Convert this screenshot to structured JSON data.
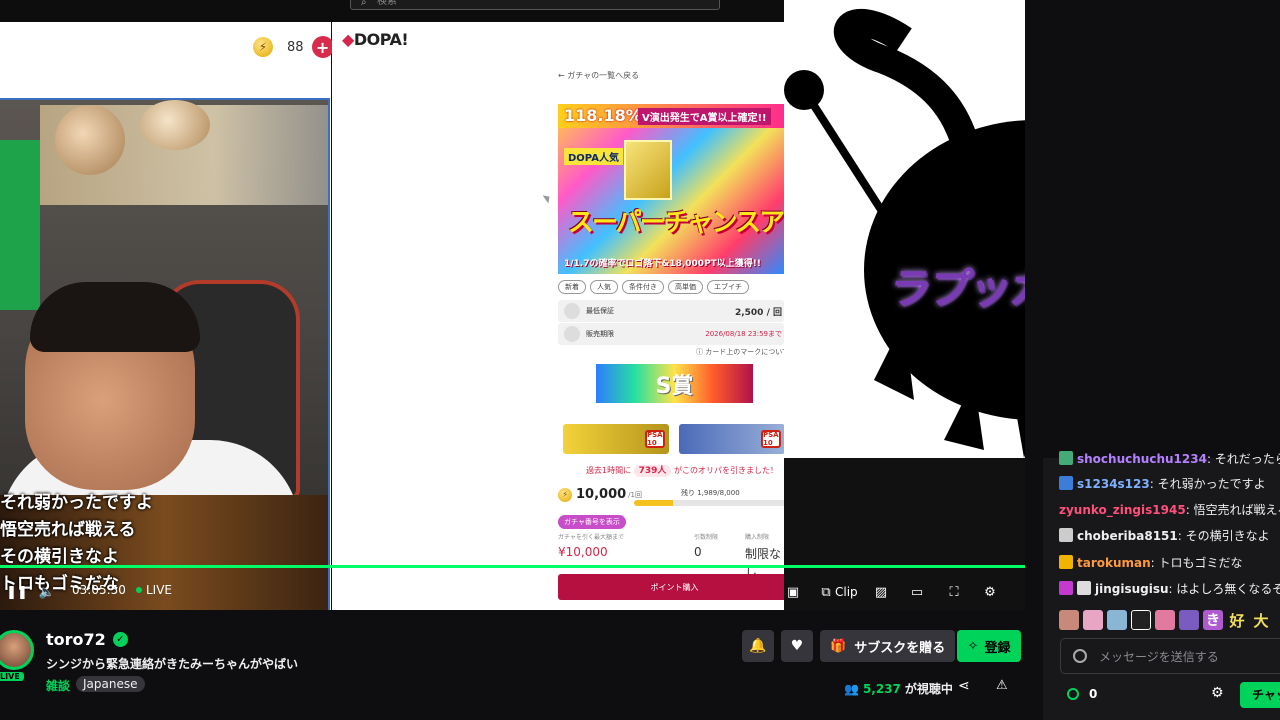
{
  "browser": {
    "search_placeholder": "検索"
  },
  "wallet": {
    "coins": "88",
    "plus_glyph": "+"
  },
  "subtitles": [
    "それ弱かったですよ",
    "悟空売れば戦える",
    "その横引きなよ",
    "トロもゴミだな"
  ],
  "dopa": {
    "logo": "DOPA!",
    "back_link": "← ガチャの一覧へ戻る",
    "banner": {
      "percent": "118.18%",
      "caption": "V演出発生でA賞以上確定!!",
      "badge": "DOPA人気",
      "main": "スーパーチャンスアップ",
      "bottom": "1/1.7の確率でロゴ落下&18,000PT以上獲得!!"
    },
    "tags": [
      "新着",
      "人気",
      "条件付き",
      "高単価",
      "エブイチ"
    ],
    "rows": [
      {
        "label": "最低保証",
        "value": "2,500 / 回"
      },
      {
        "label": "販売期限",
        "value": "2026/08/18 23:59まで"
      }
    ],
    "card_mark_link": "カード上のマークについて",
    "s_prize": "S賞",
    "prize_badge": "PSA 10",
    "history": {
      "prefix": "過去1時間に",
      "count": "739人",
      "suffix": "がこのオリパを引きました！"
    },
    "price": "10,000",
    "price_unit": "/1回",
    "remaining_label": "残り 1,989/8,000",
    "remaining_fraction": 0.249,
    "pill": "ガチャ番号を表示",
    "stats": [
      {
        "label": "ガチャを引く最大額まで",
        "value": "¥10,000"
      },
      {
        "label": "引数制限",
        "value": "0"
      },
      {
        "label": "購入制限",
        "value": "制限なし"
      }
    ],
    "buy_button": "ポイント購入"
  },
  "artwork": {
    "title": "ラプッカーズ"
  },
  "player": {
    "time": "03:05:50",
    "live_label": "LIVE",
    "clip_label": "Clip"
  },
  "chat": {
    "messages": [
      {
        "user": "shochuchuchu1234",
        "text": ": それだったら…",
        "color": "#b580ff"
      },
      {
        "user": "s1234s123",
        "text": ": それ弱かったですよ",
        "color": "#7fb0ff"
      },
      {
        "user": "zyunko_zingis1945",
        "text": ": 悟空売れば戦える",
        "color": "#ff4f7a"
      },
      {
        "user": "choberiba8151",
        "text": ": その横引きなよ",
        "color": "#efeff1"
      },
      {
        "user": "tarokuman",
        "text": ": トロもゴミだな",
        "color": "#ff9a3c"
      },
      {
        "user": "jingisugisu",
        "text": ": はよしろ無くなるぞ",
        "color": "#efeff1"
      }
    ],
    "emote_text": [
      "き",
      "好",
      "大"
    ],
    "input_placeholder": "メッセージを送信する",
    "points": "0",
    "chat_button": "チャット"
  },
  "stream": {
    "channel": "toro72",
    "live_tag": "LIVE",
    "title": "シンジから緊急連絡がきたみーちゃんがやばい",
    "category": "雑談",
    "language": "Japanese",
    "gift_button": "サブスクを贈る",
    "subscribe_button": "登録",
    "viewer_count": "5,237",
    "viewer_label": "が視聴中"
  },
  "colors": {
    "accent_green": "#00d35a",
    "dopa_red": "#d5254a",
    "background": "#0e0e10"
  }
}
